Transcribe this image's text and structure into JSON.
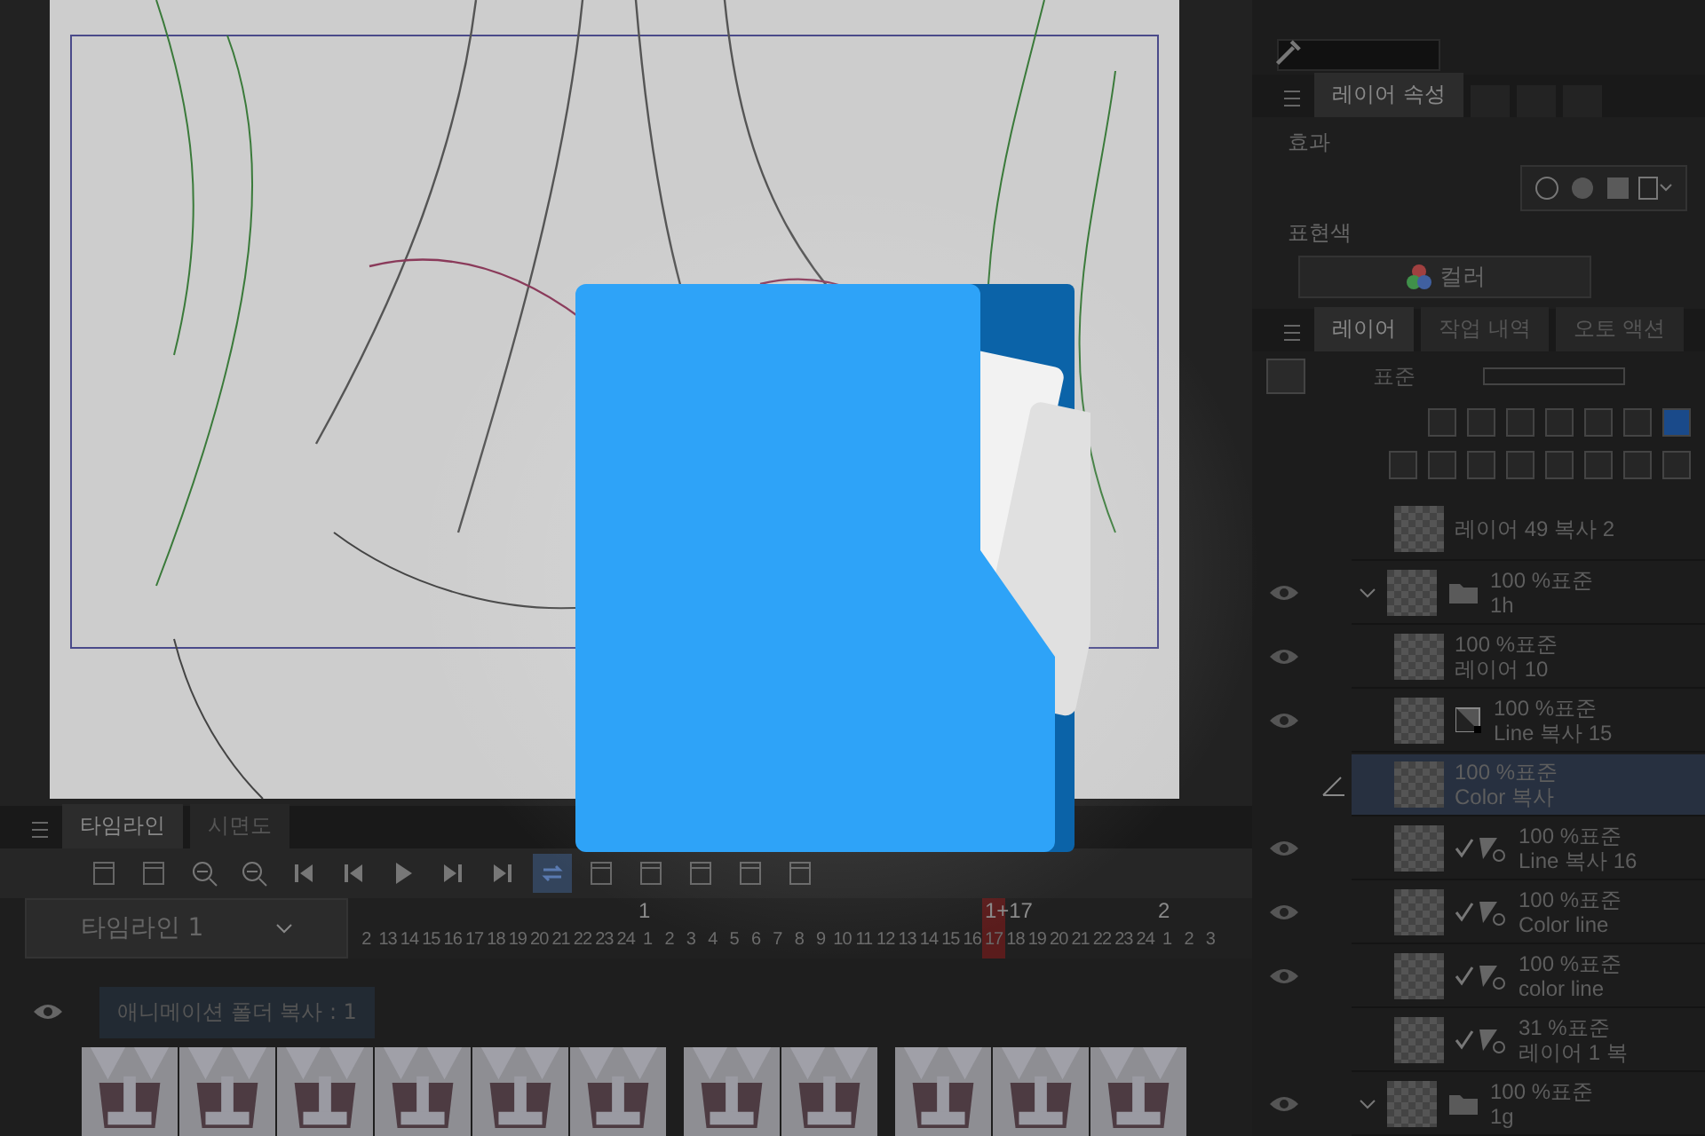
{
  "canvas": {
    "kind": "picture"
  },
  "timeline": {
    "tabs": [
      {
        "label": "타임라인",
        "selected": true
      },
      {
        "label": "시면도",
        "selected": false
      }
    ],
    "dropdown": "타임라인 1",
    "frames": [
      {
        "label": "2",
        "current": false
      },
      {
        "label": "13",
        "current": false
      },
      {
        "label": "14",
        "current": false
      },
      {
        "label": "15",
        "current": false
      },
      {
        "label": "16",
        "current": false
      },
      {
        "label": "17",
        "current": false
      },
      {
        "label": "18",
        "current": false
      },
      {
        "label": "19",
        "current": false
      },
      {
        "label": "20",
        "current": false
      },
      {
        "label": "21",
        "current": false
      },
      {
        "label": "22",
        "current": false
      },
      {
        "label": "23",
        "current": false
      },
      {
        "label": "24",
        "current": false
      },
      {
        "label": "1",
        "marker": "1",
        "current": false
      },
      {
        "label": "2",
        "current": false
      },
      {
        "label": "3",
        "current": false
      },
      {
        "label": "4",
        "current": false
      },
      {
        "label": "5",
        "current": false
      },
      {
        "label": "6",
        "current": false
      },
      {
        "label": "7",
        "current": false
      },
      {
        "label": "8",
        "current": false
      },
      {
        "label": "9",
        "current": false
      },
      {
        "label": "10",
        "current": false
      },
      {
        "label": "11",
        "current": false
      },
      {
        "label": "12",
        "current": false
      },
      {
        "label": "13",
        "current": false
      },
      {
        "label": "14",
        "current": false
      },
      {
        "label": "15",
        "current": false
      },
      {
        "label": "16",
        "current": false
      },
      {
        "label": "17",
        "marker": "1+17",
        "current": true
      },
      {
        "label": "18",
        "current": false
      },
      {
        "label": "19",
        "current": false
      },
      {
        "label": "20",
        "current": false
      },
      {
        "label": "21",
        "current": false
      },
      {
        "label": "22",
        "current": false
      },
      {
        "label": "23",
        "current": false
      },
      {
        "label": "24",
        "current": false
      },
      {
        "label": "1",
        "marker": "2",
        "current": false
      },
      {
        "label": "2",
        "current": false
      },
      {
        "label": "3",
        "current": false
      }
    ],
    "tracks": [
      {
        "name": "애니메이션 폴더 복사 : 1",
        "visible": true
      }
    ],
    "cels": [
      {
        "kind": "picture"
      },
      {
        "kind": "picture"
      },
      {
        "kind": "picture"
      },
      {
        "kind": "picture"
      },
      {
        "kind": "picture"
      },
      {
        "kind": "picture"
      },
      {
        "kind": "gap"
      },
      {
        "kind": "picture"
      },
      {
        "kind": "picture"
      },
      {
        "kind": "gap"
      },
      {
        "kind": "picture"
      },
      {
        "kind": "picture"
      },
      {
        "kind": "picture"
      }
    ]
  },
  "properties": {
    "tab": "레이어 속성",
    "effect_label": "효과",
    "color_label": "표현색",
    "color_mode": "컬러"
  },
  "layer_panel": {
    "tabs": [
      {
        "label": "레이어",
        "selected": true
      },
      {
        "label": "작업 내역",
        "selected": false
      },
      {
        "label": "오토 액션",
        "selected": false
      }
    ],
    "blend_mode": "표준",
    "layers": [
      {
        "kind": "layer",
        "name": "레이어 49 복사 2",
        "visible": false,
        "selected": false
      },
      {
        "kind": "folder",
        "mode": "100 %표준",
        "name": "1h",
        "visible": true,
        "selected": false,
        "expanded": true,
        "children": [
          {
            "kind": "layer",
            "mode": "100 %표준",
            "name": "레이어 10",
            "visible": true,
            "selected": false
          },
          {
            "kind": "mask",
            "mode": "100 %표준",
            "name": "Line 복사 15",
            "visible": true,
            "selected": false
          },
          {
            "kind": "layer",
            "mode": "100 %표준",
            "name": "Color 복사",
            "visible": false,
            "selected": true
          },
          {
            "kind": "ruler",
            "mode": "100 %표준",
            "name": "Line 복사 16",
            "visible": true,
            "selected": false
          },
          {
            "kind": "ruler",
            "mode": "100 %표준",
            "name": "Color line",
            "visible": true,
            "selected": false
          },
          {
            "kind": "ruler",
            "mode": "100 %표준",
            "name": "color line",
            "visible": true,
            "selected": false
          },
          {
            "kind": "ruler",
            "mode": "31 %표준",
            "name": "레이어 1 복",
            "visible": false,
            "selected": false
          }
        ]
      },
      {
        "kind": "folder",
        "mode": "100 %표준",
        "name": "1g",
        "visible": true,
        "selected": false,
        "expanded": true
      }
    ]
  }
}
